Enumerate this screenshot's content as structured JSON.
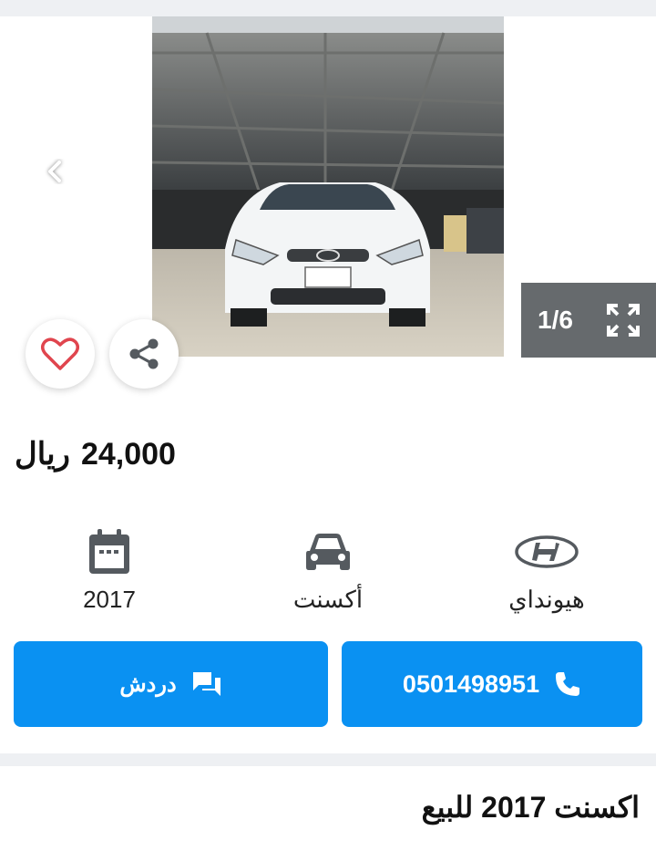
{
  "gallery": {
    "counter": "1/6",
    "icons": {
      "prev": "chevron-left-icon",
      "next": "chevron-right-icon",
      "fullscreen": "fullscreen-expand-icon",
      "favorite": "heart-icon",
      "share": "share-icon"
    }
  },
  "price": {
    "amount": "24,000",
    "currency": "ريال"
  },
  "specs": {
    "year": "2017",
    "model": "أكسنت",
    "make": "هيونداي"
  },
  "actions": {
    "chat_label": "دردش",
    "call_label": "0501498951"
  },
  "listing": {
    "title": "اكسنت 2017 للبيع"
  },
  "colors": {
    "primary": "#0a91f2",
    "heart": "#e0454e",
    "counter_bg": "#666a6d",
    "icon_gray": "#555a5f"
  }
}
